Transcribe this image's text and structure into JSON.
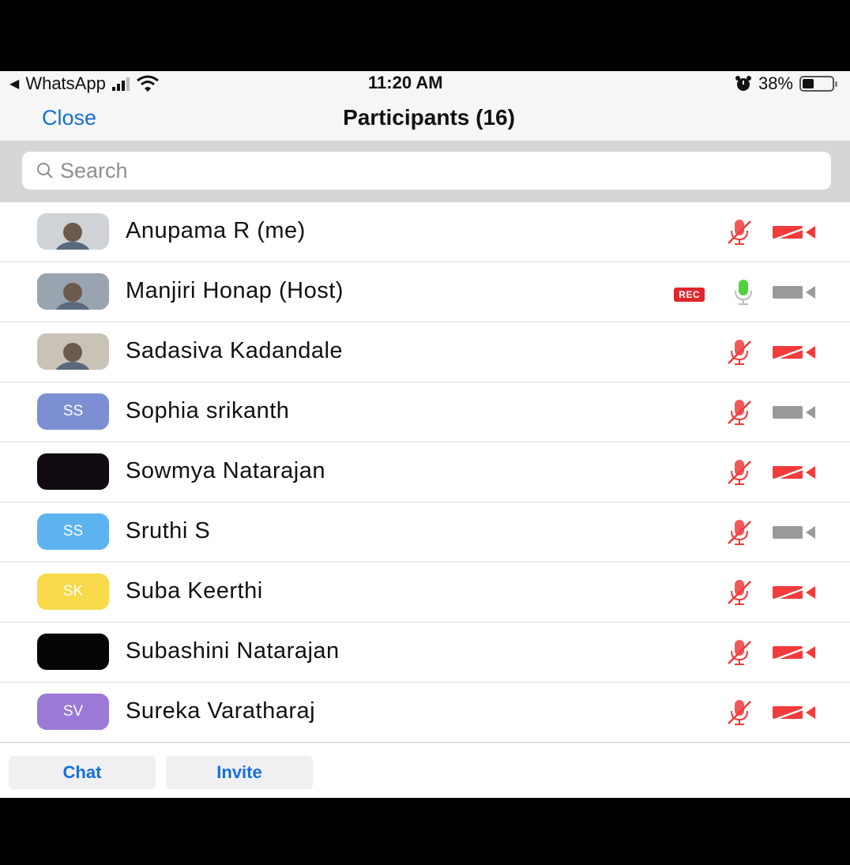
{
  "status_bar": {
    "back_app": "WhatsApp",
    "time": "11:20 AM",
    "battery": "38%",
    "battery_level": 0.38
  },
  "header": {
    "close_label": "Close",
    "title": "Participants (16)"
  },
  "search": {
    "placeholder": "Search"
  },
  "participants": [
    {
      "name": "Anupama R (me)",
      "avatar_type": "photo",
      "avatar_initials": "",
      "avatar_color": "#cfd3d6",
      "rec": false,
      "mic": "muted",
      "video": "off"
    },
    {
      "name": "Manjiri Honap (Host)",
      "avatar_type": "photo",
      "avatar_initials": "",
      "avatar_color": "#9aa4b0",
      "rec": true,
      "rec_label": "REC",
      "mic": "on",
      "video": "grey"
    },
    {
      "name": "Sadasiva Kadandale",
      "avatar_type": "photo",
      "avatar_initials": "",
      "avatar_color": "#c9c2b6",
      "rec": false,
      "mic": "muted",
      "video": "off"
    },
    {
      "name": "Sophia srikanth",
      "avatar_type": "initials",
      "avatar_initials": "SS",
      "avatar_color": "#7d8fd3",
      "rec": false,
      "mic": "muted",
      "video": "grey"
    },
    {
      "name": "Sowmya Natarajan",
      "avatar_type": "solid",
      "avatar_initials": "",
      "avatar_color": "#120b12",
      "rec": false,
      "mic": "muted",
      "video": "off"
    },
    {
      "name": "Sruthi S",
      "avatar_type": "initials",
      "avatar_initials": "SS",
      "avatar_color": "#5db3ef",
      "rec": false,
      "mic": "muted",
      "video": "grey"
    },
    {
      "name": "Suba Keerthi",
      "avatar_type": "initials",
      "avatar_initials": "SK",
      "avatar_color": "#f7d94a",
      "rec": false,
      "mic": "muted",
      "video": "off"
    },
    {
      "name": "Subashini Natarajan",
      "avatar_type": "solid",
      "avatar_initials": "",
      "avatar_color": "#050505",
      "rec": false,
      "mic": "muted",
      "video": "off"
    },
    {
      "name": "Sureka Varatharaj",
      "avatar_type": "initials",
      "avatar_initials": "SV",
      "avatar_color": "#9b79d6",
      "rec": false,
      "mic": "muted",
      "video": "off"
    }
  ],
  "footer": {
    "chat_label": "Chat",
    "invite_label": "Invite"
  },
  "colors": {
    "accent_blue": "#1570d8",
    "muted_red": "#f23b3b",
    "mic_green": "#4cd23c",
    "video_grey": "#9a9a9a"
  }
}
